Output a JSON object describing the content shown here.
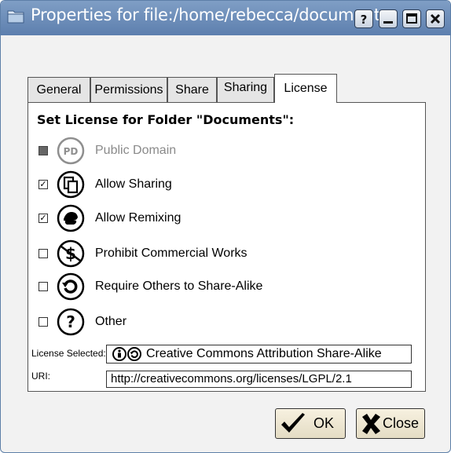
{
  "window": {
    "title": "Properties for file:/home/rebecca/documents",
    "title_icon": "folder-icon",
    "title_buttons": [
      "help-icon",
      "minimize-icon",
      "maximize-icon",
      "close-icon"
    ]
  },
  "tabs": [
    {
      "label": "General",
      "active": false
    },
    {
      "label": "Permissions",
      "active": false
    },
    {
      "label": "Share",
      "active": false
    },
    {
      "label": "Sharing",
      "active": false
    },
    {
      "label": "License",
      "active": true
    }
  ],
  "license": {
    "heading": "Set License for Folder \"Documents\":",
    "options": [
      {
        "label": "Public Domain",
        "icon": "public-domain-icon",
        "state": "disabled"
      },
      {
        "label": "Allow Sharing",
        "icon": "sharing-icon",
        "state": "checked"
      },
      {
        "label": "Allow Remixing",
        "icon": "remix-icon",
        "state": "checked"
      },
      {
        "label": "Prohibit Commercial Works",
        "icon": "noncommercial-icon",
        "state": "unchecked"
      },
      {
        "label": "Require Others to Share-Alike",
        "icon": "share-alike-icon",
        "state": "unchecked"
      },
      {
        "label": "Other",
        "icon": "question-icon",
        "state": "unchecked"
      }
    ],
    "selected_label": "License Selected:",
    "selected_value": "Creative Commons Attribution Share-Alike",
    "uri_label": "URI:",
    "uri_value": "http://creativecommons.org/licenses/LGPL/2.1"
  },
  "buttons": {
    "ok": "OK",
    "close": "Close"
  },
  "colors": {
    "titlebar": "#6b8cb8",
    "window_bg": "#f2f2f2",
    "button_bg": "#efe7d2"
  }
}
